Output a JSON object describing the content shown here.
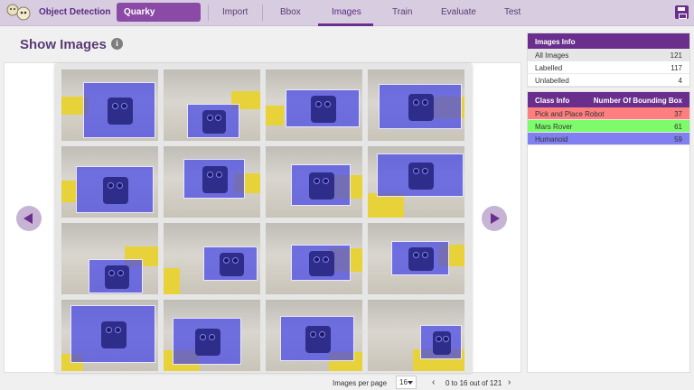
{
  "header": {
    "app_title": "Object Detection",
    "project_name": "Quarky",
    "tabs": [
      {
        "label": "Import",
        "active": false
      },
      {
        "label": "Bbox",
        "active": false
      },
      {
        "label": "Images",
        "active": true
      },
      {
        "label": "Train",
        "active": false
      },
      {
        "label": "Evaluate",
        "active": false
      },
      {
        "label": "Test",
        "active": false
      }
    ],
    "icons": {
      "logo": "robot-mascot-logo",
      "save": "save-icon"
    },
    "accent_color": "#6a2f8c"
  },
  "page": {
    "title": "Show Images",
    "info_glyph": "i"
  },
  "gallery": {
    "image_count_shown": 16,
    "prev_icon": "arrow-left-icon",
    "next_icon": "arrow-right-icon"
  },
  "pagination": {
    "items_per_page_label": "Images per page",
    "items_per_page_value": "16",
    "range_text": "0 to 16 out of 121",
    "prev_glyph": "‹",
    "next_glyph": "›"
  },
  "images_info": {
    "title": "Images Info",
    "rows": [
      {
        "label": "All Images",
        "value": "121"
      },
      {
        "label": "Labelled",
        "value": "117"
      },
      {
        "label": "Unlabelled",
        "value": "4"
      }
    ]
  },
  "class_info": {
    "title": "Class Info",
    "count_header": "Number Of Bounding Box",
    "rows": [
      {
        "label": "Pick and Place Robot",
        "value": "37",
        "color": "#ff7f7f"
      },
      {
        "label": "Mars Rover",
        "value": "61",
        "color": "#7cfc6a"
      },
      {
        "label": "Humanoid",
        "value": "59",
        "color": "#8080f0"
      }
    ]
  }
}
